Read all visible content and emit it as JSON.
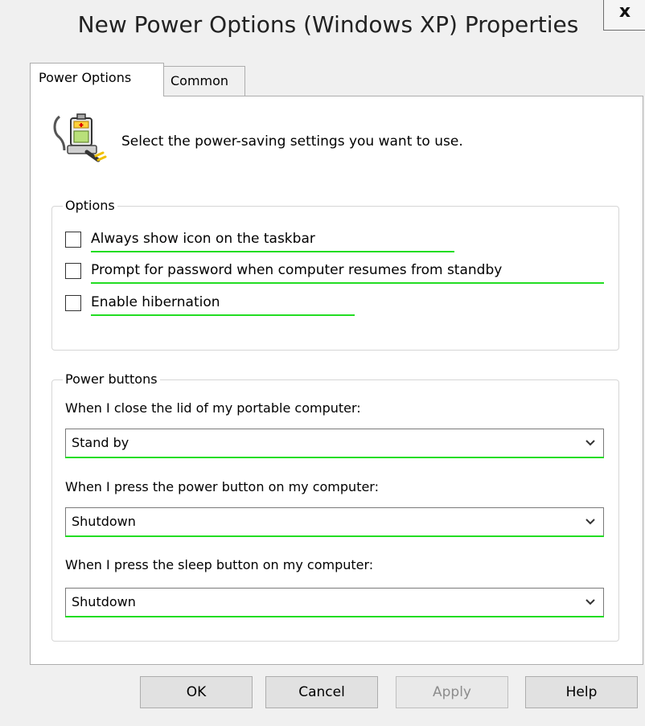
{
  "window": {
    "title": "New Power Options (Windows XP) Properties",
    "close_glyph": "x"
  },
  "tabs": [
    {
      "label": "Power Options",
      "active": true
    },
    {
      "label": "Common",
      "active": false
    }
  ],
  "header": {
    "icon": "power-battery-icon",
    "text": "Select the power-saving settings you want to use."
  },
  "options_group": {
    "legend": "Options",
    "checkboxes": [
      {
        "label": "Always show icon on the taskbar",
        "checked": false
      },
      {
        "label": "Prompt for password when computer resumes from standby",
        "checked": false
      },
      {
        "label": "Enable hibernation",
        "checked": false
      }
    ]
  },
  "power_buttons_group": {
    "legend": "Power buttons",
    "fields": [
      {
        "label": "When I close the lid of my portable computer:",
        "value": "Stand by"
      },
      {
        "label": "When I press the power button on my computer:",
        "value": "Shutdown"
      },
      {
        "label": "When I press the sleep button on my computer:",
        "value": "Shutdown"
      }
    ]
  },
  "buttons": {
    "ok": "OK",
    "cancel": "Cancel",
    "apply": "Apply",
    "help": "Help"
  },
  "colors": {
    "highlight_underline": "#22dd22",
    "disabled_text": "#8c8c8c"
  }
}
